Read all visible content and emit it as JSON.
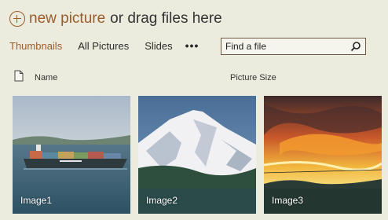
{
  "header": {
    "new_picture_label": "new picture",
    "drag_hint": "or drag files here"
  },
  "tabs": [
    {
      "label": "Thumbnails",
      "active": true
    },
    {
      "label": "All Pictures",
      "active": false
    },
    {
      "label": "Slides",
      "active": false
    }
  ],
  "more_label": "•••",
  "search": {
    "placeholder": "Find a file"
  },
  "columns": {
    "name": "Name",
    "picture_size": "Picture Size"
  },
  "pictures": [
    {
      "caption": "Image1",
      "subject": "container ship on water"
    },
    {
      "caption": "Image2",
      "subject": "snow-capped mountain"
    },
    {
      "caption": "Image3",
      "subject": "sunset over water"
    }
  ],
  "colors": {
    "accent": "#9c5b2b",
    "background": "#ebecdd"
  },
  "icons": [
    "plus-circle-icon",
    "search-icon",
    "document-icon"
  ]
}
